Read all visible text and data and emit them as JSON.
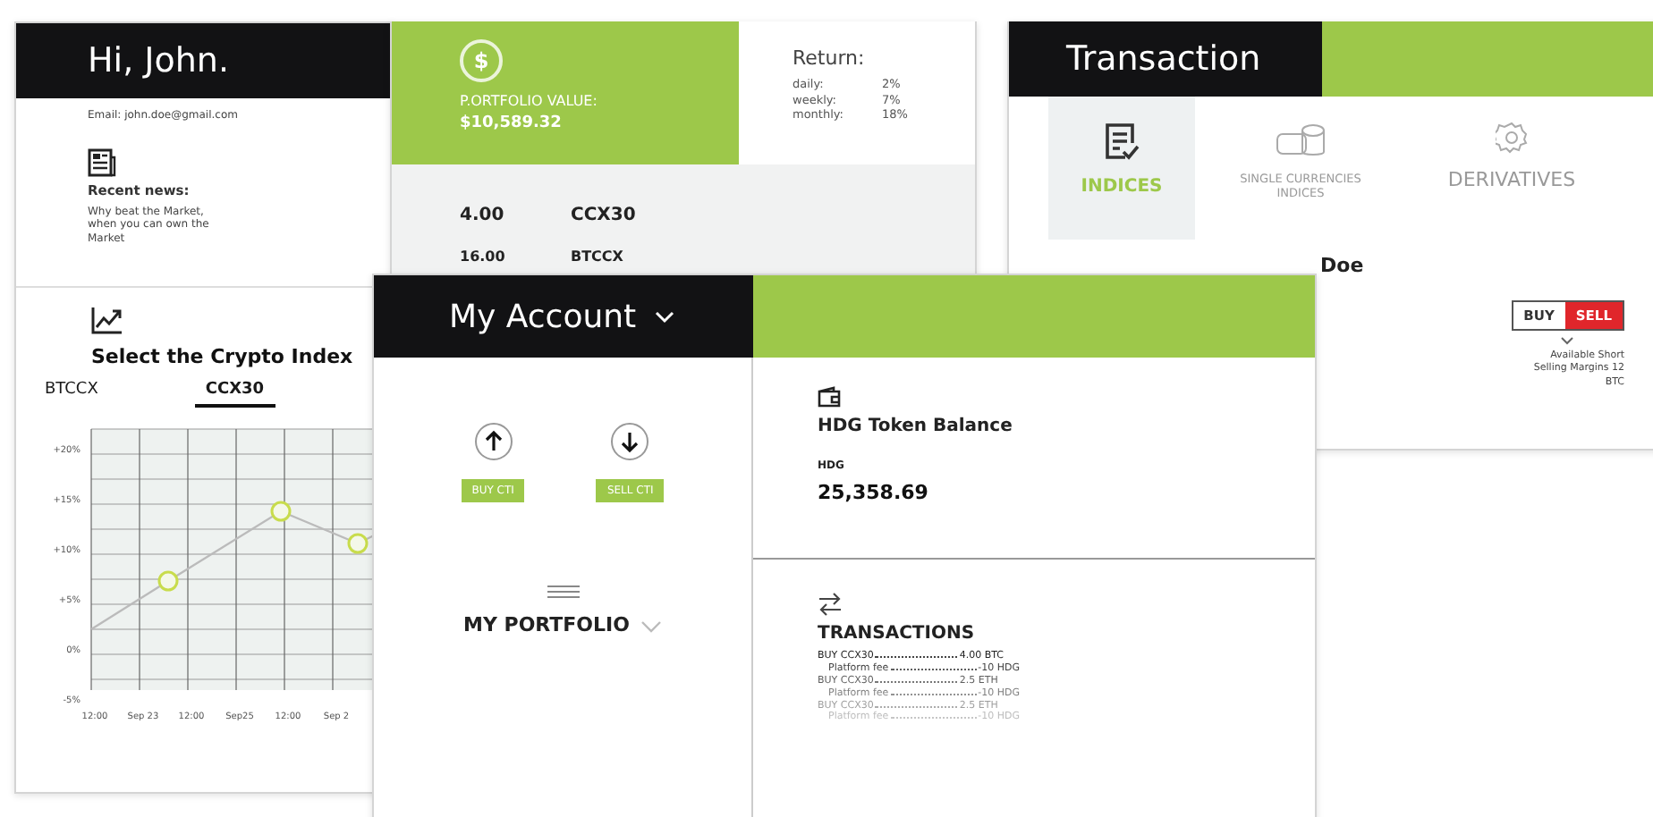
{
  "profile_card": {
    "greeting": "Hi, John.",
    "email": "Email: john.doe@gmail.com",
    "news_title": "Recent news:",
    "news_text": "Why beat the Market, when you can own the Market",
    "index_title": "Select the Crypto Index",
    "index_tabs": [
      {
        "label": "BTCCX",
        "selected": false
      },
      {
        "label": "CCX30",
        "selected": true
      }
    ],
    "chart_yticks": [
      "+20%",
      "+15%",
      "+10%",
      "+5%",
      "0%",
      "-5%"
    ],
    "chart_xticks": [
      "12:00",
      "Sep 23",
      "12:00",
      "Sep25",
      "12:00",
      "Sep 2"
    ]
  },
  "portfolio_card": {
    "currency_symbol": "$",
    "value_label": "P.ORTFOLIO VALUE:",
    "value": "$10,589.32",
    "return_title": "Return:",
    "returns": [
      {
        "period": "daily:",
        "value": "2%"
      },
      {
        "period": "weekly:",
        "value": "7%"
      },
      {
        "period": "monthly:",
        "value": "18%"
      }
    ],
    "holdings": [
      {
        "amount": "4.00",
        "symbol": "CCX30"
      },
      {
        "amount": "16.00",
        "symbol": "BTCCX"
      }
    ]
  },
  "transaction_card": {
    "title": "Transaction",
    "tabs": [
      {
        "label": "INDICES",
        "selected": true,
        "kind": "list"
      },
      {
        "label": "SINGLE CURRENCIES INDICES",
        "selected": false,
        "kind": "coins"
      },
      {
        "label": "DERIVATIVES",
        "selected": false,
        "kind": "gear"
      }
    ],
    "name_fragment": "Doe",
    "trade_toggle": [
      {
        "label": "BUY",
        "selected": false
      },
      {
        "label": "SELL",
        "selected": true
      }
    ],
    "margin_note": "Available Short Selling Margins 12 BTC"
  },
  "account_card": {
    "title": "My Account",
    "actions": [
      {
        "label": "BUY CTI",
        "kind": "up"
      },
      {
        "label": "SELL CTI",
        "kind": "down"
      }
    ],
    "portfolio_label": "MY PORTFOLIO",
    "balance_title": "HDG Token Balance",
    "balance_unit": "HDG",
    "balance": "25,358.69",
    "transactions_title": "TRANSACTIONS",
    "transactions": [
      {
        "label": "BUY CCX30",
        "amount": "4.00 BTC",
        "kind": "trade"
      },
      {
        "label": "Platform fee",
        "amount": "-10 HDG",
        "kind": "fee"
      },
      {
        "label": "BUY CCX30",
        "amount": "2.5 ETH",
        "kind": "trade"
      },
      {
        "label": "Platform fee",
        "amount": "-10 HDG",
        "kind": "fee"
      },
      {
        "label": "BUY CCX30",
        "amount": "2.5 ETH",
        "kind": "trade"
      },
      {
        "label": "Platform fee",
        "amount": "-10 HDG",
        "kind": "fee"
      }
    ]
  }
}
